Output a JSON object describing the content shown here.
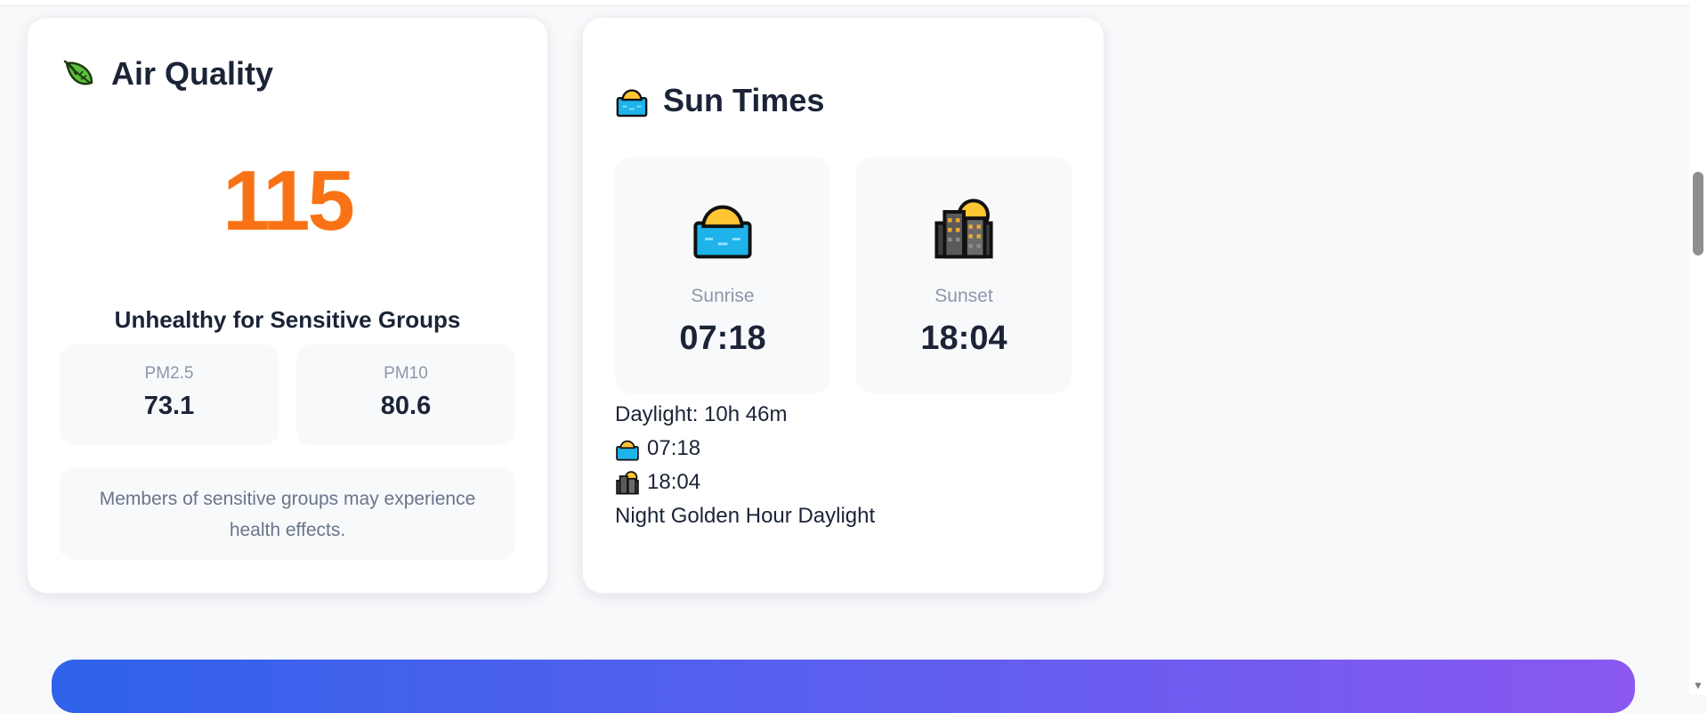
{
  "air_quality": {
    "title": "Air Quality",
    "icon": "leaf-icon",
    "aqi": "115",
    "category": "Unhealthy for Sensitive Groups",
    "accent_color": "#f97316",
    "pm25": {
      "label": "PM2.5",
      "value": "73.1"
    },
    "pm10": {
      "label": "PM10",
      "value": "80.6"
    },
    "health_message": "Members of sensitive groups may experience health effects."
  },
  "sun_times": {
    "title": "Sun Times",
    "icon": "sunrise-icon",
    "sunrise": {
      "label": "Sunrise",
      "time": "07:18",
      "icon": "sunrise-icon"
    },
    "sunset": {
      "label": "Sunset",
      "time": "18:04",
      "icon": "sunset-city-icon"
    },
    "daylight": "Daylight: 10h 46m",
    "sunrise_line": "07:18",
    "sunset_line": "18:04",
    "phases": "Night Golden Hour Daylight"
  },
  "banner": {
    "gradient_start": "#2f62ea",
    "gradient_end": "#8a58f0"
  },
  "scrollbar": {
    "arrow": "▼"
  }
}
